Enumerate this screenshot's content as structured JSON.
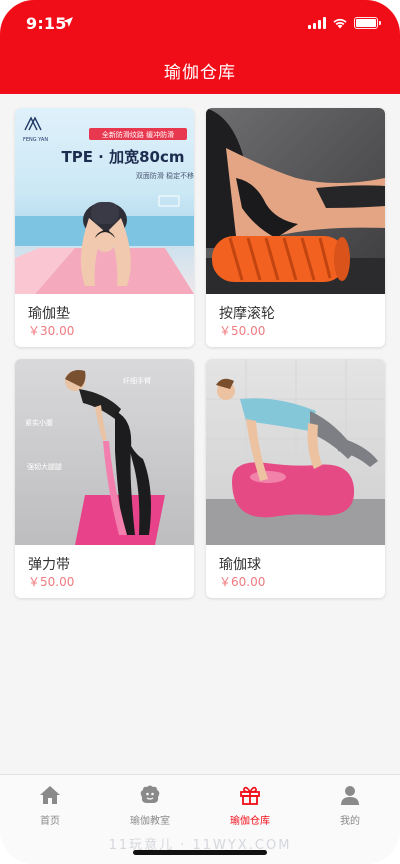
{
  "status_bar": {
    "time": "9:15"
  },
  "header": {
    "title": "瑜伽仓库"
  },
  "products": [
    {
      "name": "瑜伽垫",
      "price": "￥30.00",
      "image": {
        "badge": "全新防滑纹路 缓冲防滑",
        "headline": "TPE · 加宽80cm",
        "sub": "双面防滑 稳定不移",
        "logo": "FENG YAN"
      }
    },
    {
      "name": "按摩滚轮",
      "price": "￥50.00"
    },
    {
      "name": "弹力带",
      "price": "￥50.00",
      "image": {
        "label_1": "纤细手臂",
        "label_2": "紧实小腹",
        "label_3": "强韧大腿腿"
      }
    },
    {
      "name": "瑜伽球",
      "price": "￥60.00"
    }
  ],
  "tabbar": {
    "items": [
      {
        "label": "首页",
        "icon": "home-icon",
        "active": false
      },
      {
        "label": "瑜伽教室",
        "icon": "classroom-icon",
        "active": false
      },
      {
        "label": "瑜伽仓库",
        "icon": "gift-icon",
        "active": true
      },
      {
        "label": "我的",
        "icon": "profile-icon",
        "active": false
      }
    ]
  },
  "watermark": "11玩意儿 · 11WYX.COM",
  "colors": {
    "brand": "#f10d18",
    "price": "#f07b80",
    "tab_inactive": "#8a8a8a"
  }
}
